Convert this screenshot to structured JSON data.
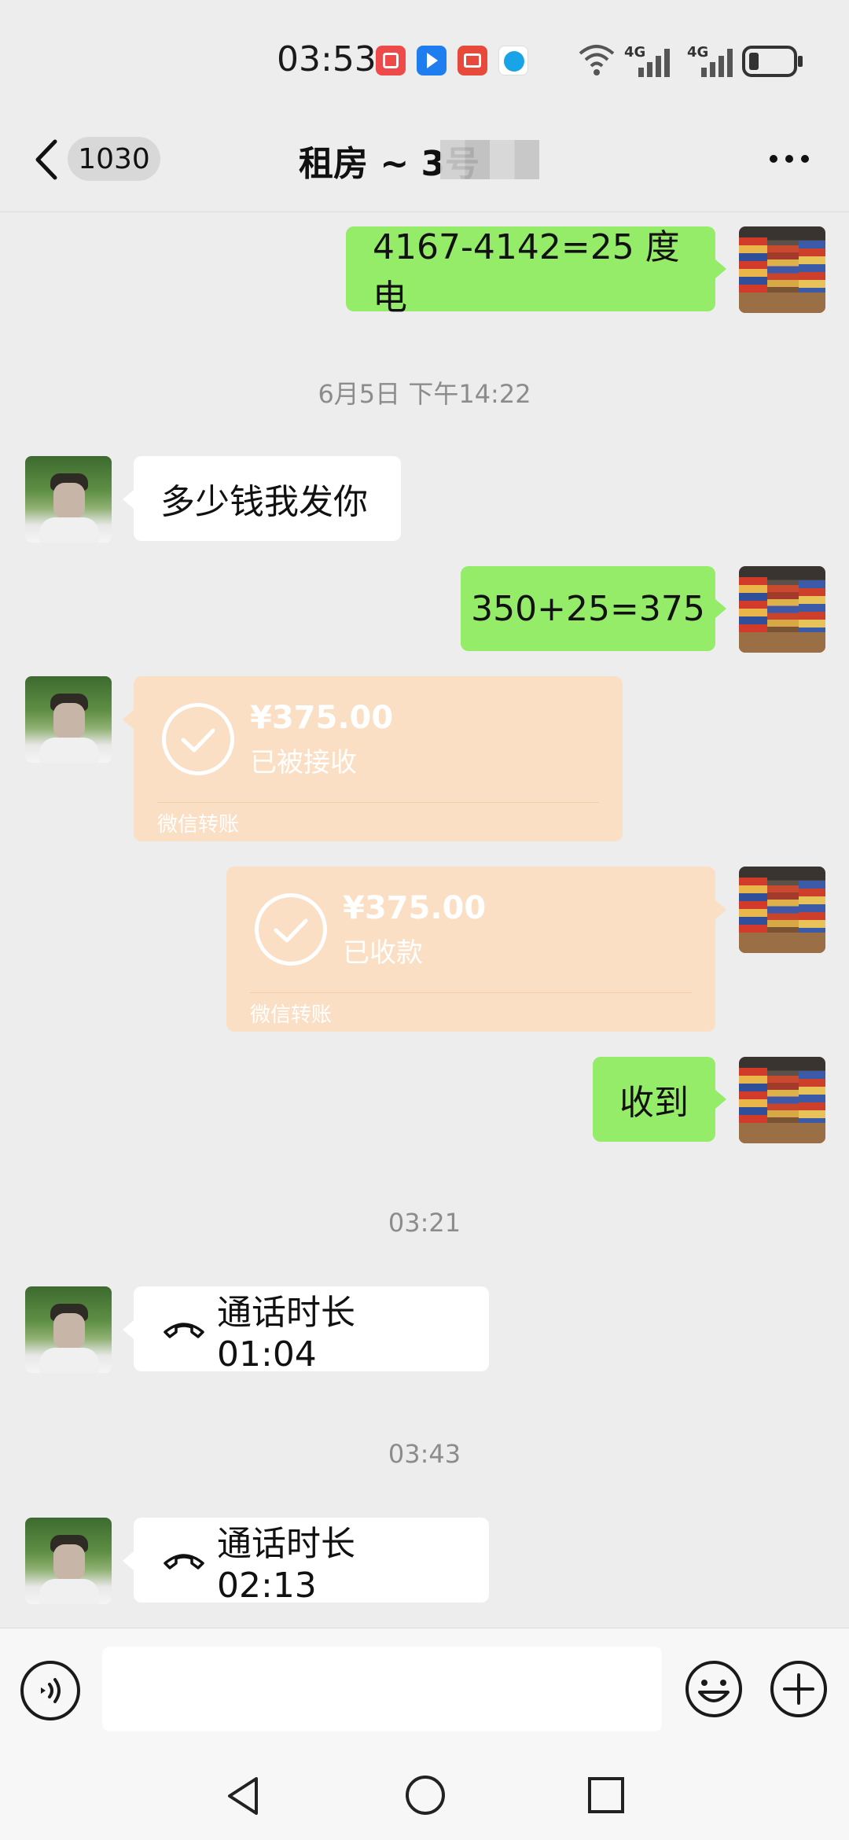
{
  "status_bar": {
    "time": "03:53",
    "network_1": "4G",
    "network_2": "4G"
  },
  "header": {
    "unread_count": "1030",
    "title": "租房 ~ 3号"
  },
  "messages": [
    {
      "side": "me",
      "type": "text",
      "text": "4167-4142=25 度电"
    },
    {
      "type": "timestamp",
      "text": "6月5日 下午14:22"
    },
    {
      "side": "other",
      "type": "text",
      "text": "多少钱我发你"
    },
    {
      "side": "me",
      "type": "text",
      "text": "350+25=375"
    },
    {
      "side": "other",
      "type": "transfer",
      "amount": "¥375.00",
      "status": "已被接收",
      "footer": "微信转账"
    },
    {
      "side": "me",
      "type": "transfer",
      "amount": "¥375.00",
      "status": "已收款",
      "footer": "微信转账"
    },
    {
      "side": "me",
      "type": "text",
      "text": "收到"
    },
    {
      "type": "timestamp",
      "text": "03:21"
    },
    {
      "side": "other",
      "type": "call",
      "text": "通话时长 01:04"
    },
    {
      "type": "timestamp",
      "text": "03:43"
    },
    {
      "side": "other",
      "type": "call",
      "text": "通话时长 02:13"
    }
  ],
  "colors": {
    "background": "#ededed",
    "my_bubble": "#95ec69",
    "their_bubble": "#ffffff",
    "transfer_card": "#fbdfc4"
  },
  "icons": {
    "back": "chevron-left-icon",
    "more": "more-dots-icon",
    "voice": "voice-icon",
    "emoji": "emoji-icon",
    "plus": "plus-icon",
    "call": "phone-hangup-icon",
    "check": "check-circle-icon"
  }
}
